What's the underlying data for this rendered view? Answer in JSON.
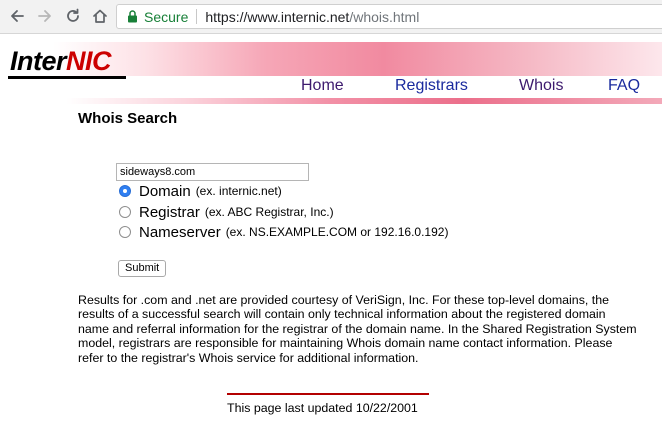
{
  "browser": {
    "secure_label": "Secure",
    "url_main": "https://www.internic.net",
    "url_path": "/whois.html",
    "icons": [
      "back-arrow-icon",
      "forward-arrow-icon",
      "reload-icon",
      "home-icon",
      "lock-icon"
    ]
  },
  "header": {
    "logo_part1": "Inter",
    "logo_part2": "NIC",
    "nav": {
      "home": "Home",
      "registrars": "Registrars",
      "whois": "Whois",
      "faq": "FAQ"
    },
    "colors": {
      "logo_accent": "#cc0000",
      "band_pink": "#f18aa0"
    }
  },
  "page": {
    "title": "Whois Search"
  },
  "form": {
    "query_value": "sideways8.com",
    "options": [
      {
        "label": "Domain",
        "example": "(ex. internic.net)",
        "checked": true
      },
      {
        "label": "Registrar",
        "example": "(ex. ABC Registrar, Inc.)",
        "checked": false
      },
      {
        "label": "Nameserver",
        "example": "(ex. NS.EXAMPLE.COM or 192.16.0.192)",
        "checked": false
      }
    ],
    "submit_label": "Submit"
  },
  "info": {
    "text": "Results for .com and .net are provided courtesy of VeriSign, Inc. For these top-level domains, the results of a successful search will contain only technical information about the registered domain name and referral information for the registrar of the domain name. In the Shared Registration System model, registrars are responsible for maintaining Whois domain name contact information. Please refer to the registrar's Whois service for additional information."
  },
  "footer": {
    "updated": "This page last updated 10/22/2001"
  }
}
